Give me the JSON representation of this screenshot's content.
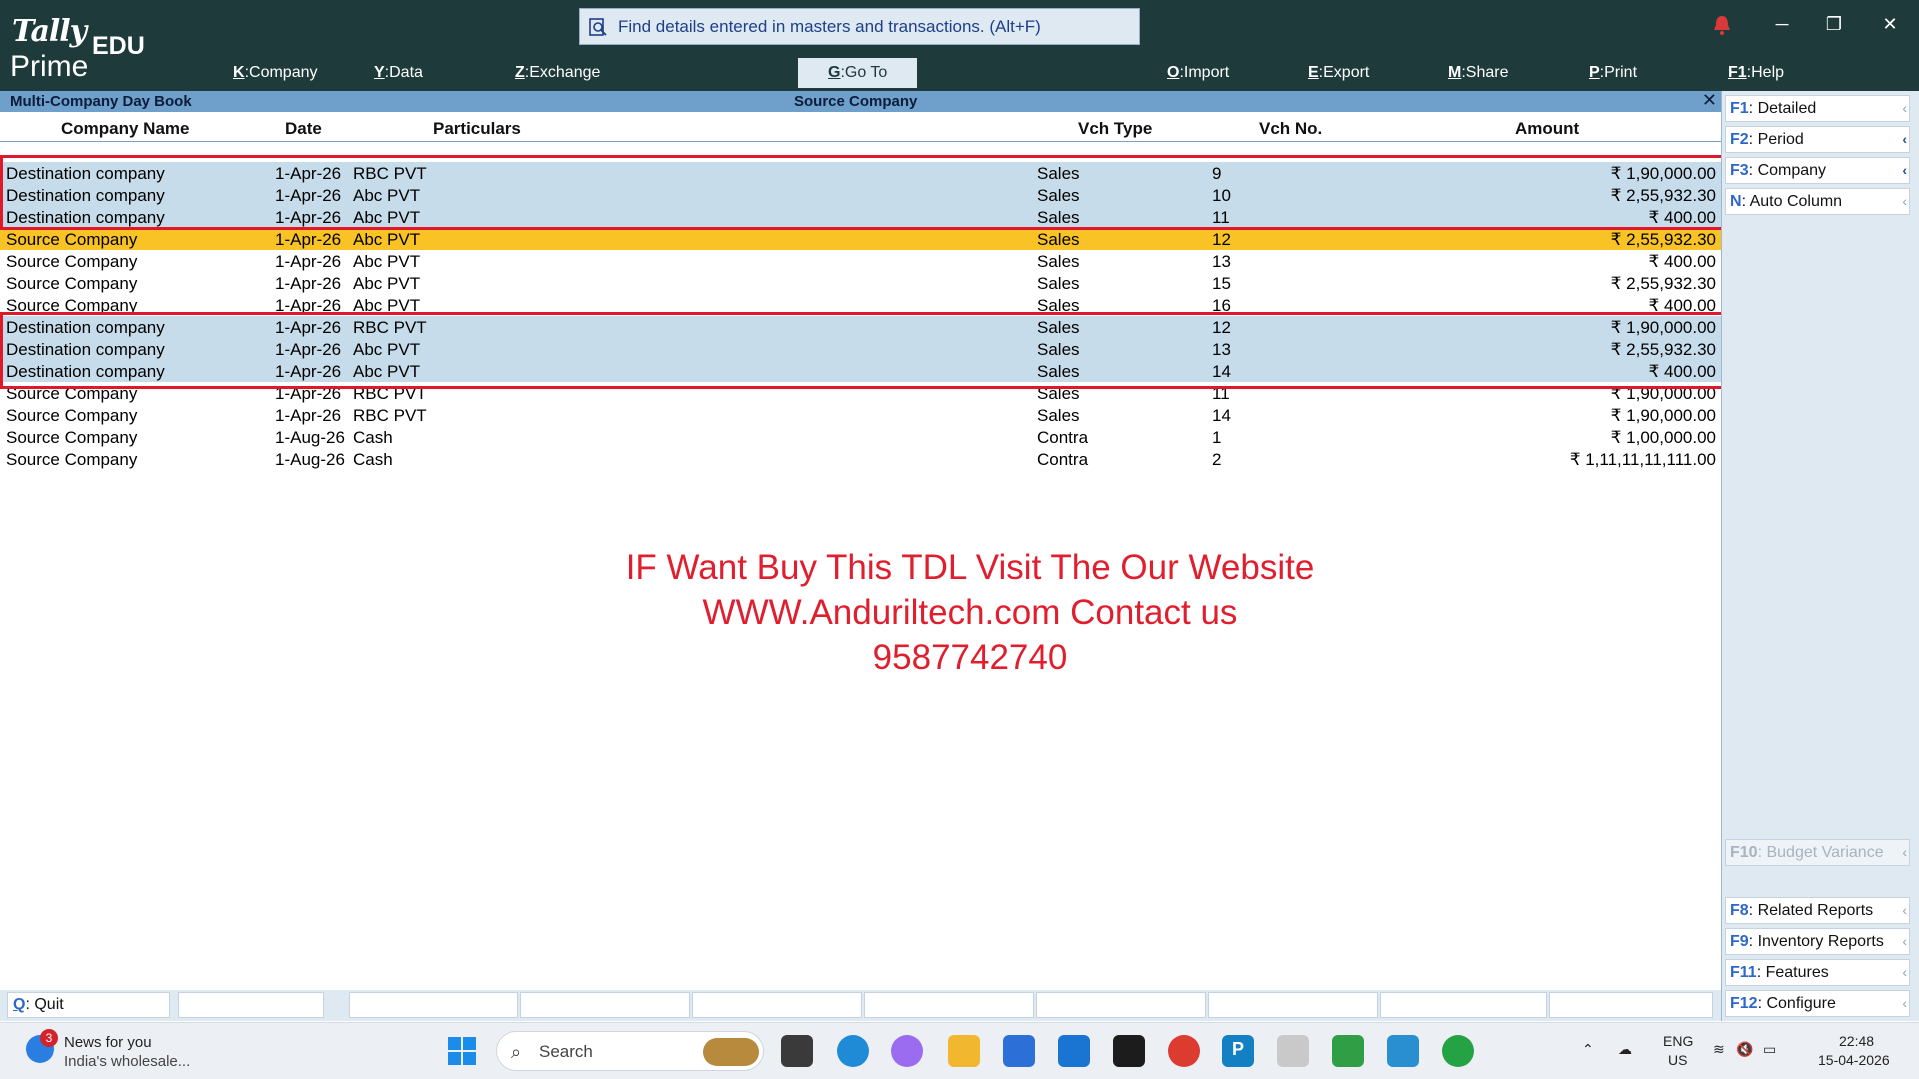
{
  "app": {
    "logo_top": "Tally",
    "logo_bottom": "Prime",
    "edition": "EDU"
  },
  "search": {
    "placeholder": "Find details entered in masters and transactions. (Alt+F)",
    "icon": "search-doc-icon"
  },
  "menu": [
    {
      "key": "K",
      "label": "Company"
    },
    {
      "key": "Y",
      "label": "Data"
    },
    {
      "key": "Z",
      "label": "Exchange"
    },
    {
      "key": "G",
      "label": "Go To"
    },
    {
      "key": "O",
      "label": "Import"
    },
    {
      "key": "E",
      "label": "Export"
    },
    {
      "key": "M",
      "label": "Share"
    },
    {
      "key": "P",
      "label": "Print"
    },
    {
      "key": "F1",
      "label": "Help"
    }
  ],
  "report": {
    "title": "Multi-Company Day Book",
    "company": "Source Company",
    "close_symbol": "✕"
  },
  "columns": {
    "company": "Company Name",
    "date": "Date",
    "particulars": "Particulars",
    "vch_type": "Vch Type",
    "vch_no": "Vch No.",
    "amount": "Amount"
  },
  "rows": [
    {
      "company": "Destination company",
      "date": "1-Apr-26",
      "particulars": "RBC PVT",
      "vch_type": "Sales",
      "vch_no": "9",
      "amount": "₹ 1,90,000.00",
      "style": "blue"
    },
    {
      "company": "Destination company",
      "date": "1-Apr-26",
      "particulars": "Abc PVT",
      "vch_type": "Sales",
      "vch_no": "10",
      "amount": "₹ 2,55,932.30",
      "style": "blue"
    },
    {
      "company": "Destination company",
      "date": "1-Apr-26",
      "particulars": "Abc PVT",
      "vch_type": "Sales",
      "vch_no": "11",
      "amount": "₹ 400.00",
      "style": "blue"
    },
    {
      "company": "Source Company",
      "date": "1-Apr-26",
      "particulars": "Abc PVT",
      "vch_type": "Sales",
      "vch_no": "12",
      "amount": "₹ 2,55,932.30",
      "style": "yellow"
    },
    {
      "company": "Source Company",
      "date": "1-Apr-26",
      "particulars": "Abc PVT",
      "vch_type": "Sales",
      "vch_no": "13",
      "amount": "₹ 400.00",
      "style": "none"
    },
    {
      "company": "Source Company",
      "date": "1-Apr-26",
      "particulars": "Abc PVT",
      "vch_type": "Sales",
      "vch_no": "15",
      "amount": "₹ 2,55,932.30",
      "style": "none"
    },
    {
      "company": "Source Company",
      "date": "1-Apr-26",
      "particulars": "Abc PVT",
      "vch_type": "Sales",
      "vch_no": "16",
      "amount": "₹ 400.00",
      "style": "none"
    },
    {
      "company": "Destination company",
      "date": "1-Apr-26",
      "particulars": "RBC PVT",
      "vch_type": "Sales",
      "vch_no": "12",
      "amount": "₹ 1,90,000.00",
      "style": "blue"
    },
    {
      "company": "Destination company",
      "date": "1-Apr-26",
      "particulars": "Abc PVT",
      "vch_type": "Sales",
      "vch_no": "13",
      "amount": "₹ 2,55,932.30",
      "style": "blue"
    },
    {
      "company": "Destination company",
      "date": "1-Apr-26",
      "particulars": "Abc PVT",
      "vch_type": "Sales",
      "vch_no": "14",
      "amount": "₹ 400.00",
      "style": "blue"
    },
    {
      "company": "Source Company",
      "date": "1-Apr-26",
      "particulars": "RBC PVT",
      "vch_type": "Sales",
      "vch_no": "11",
      "amount": "₹ 1,90,000.00",
      "style": "none"
    },
    {
      "company": "Source Company",
      "date": "1-Apr-26",
      "particulars": "RBC PVT",
      "vch_type": "Sales",
      "vch_no": "14",
      "amount": "₹ 1,90,000.00",
      "style": "none"
    },
    {
      "company": "Source Company",
      "date": "1-Aug-26",
      "particulars": "Cash",
      "vch_type": "Contra",
      "vch_no": "1",
      "amount": "₹ 1,00,000.00",
      "style": "none"
    },
    {
      "company": "Source Company",
      "date": "1-Aug-26",
      "particulars": "Cash",
      "vch_type": "Contra",
      "vch_no": "2",
      "amount": "₹ 1,11,11,11,111.00",
      "style": "none"
    }
  ],
  "promo": [
    "IF Want Buy This TDL Visit The Our Website",
    "WWW.Anduriltech.com Contact us",
    "9587742740"
  ],
  "side_buttons": [
    {
      "key": "F1",
      "label": "Detailed",
      "state": "normal"
    },
    {
      "key": "F2",
      "label": "Period",
      "state": "active"
    },
    {
      "key": "F3",
      "label": "Company",
      "state": "active"
    },
    {
      "key": "N",
      "label": "Auto Column",
      "state": "normal"
    },
    {
      "key": "F10",
      "label": "Budget Variance",
      "state": "disabled"
    },
    {
      "key": "F8",
      "label": "Related Reports",
      "state": "normal"
    },
    {
      "key": "F9",
      "label": "Inventory Reports",
      "state": "normal"
    },
    {
      "key": "F11",
      "label": "Features",
      "state": "normal"
    },
    {
      "key": "F12",
      "label": "Configure",
      "state": "normal"
    }
  ],
  "bottom": {
    "quit_key": "Q",
    "quit_label": "Quit"
  },
  "taskbar": {
    "news_title": "News for you",
    "news_sub": "India's wholesale...",
    "news_badge": "3",
    "search_label": "Search",
    "lang": "ENG",
    "region": "US",
    "time": "22:48",
    "date": "15-04-2026"
  },
  "colors": {
    "topbar": "#1e3a3a",
    "title_strip": "#6f9fcb",
    "row_blue": "#c7dcea",
    "row_yellow": "#f9c325",
    "red_box": "#e0192a",
    "promo": "#e01e2e",
    "key_blue": "#2e67c9"
  }
}
